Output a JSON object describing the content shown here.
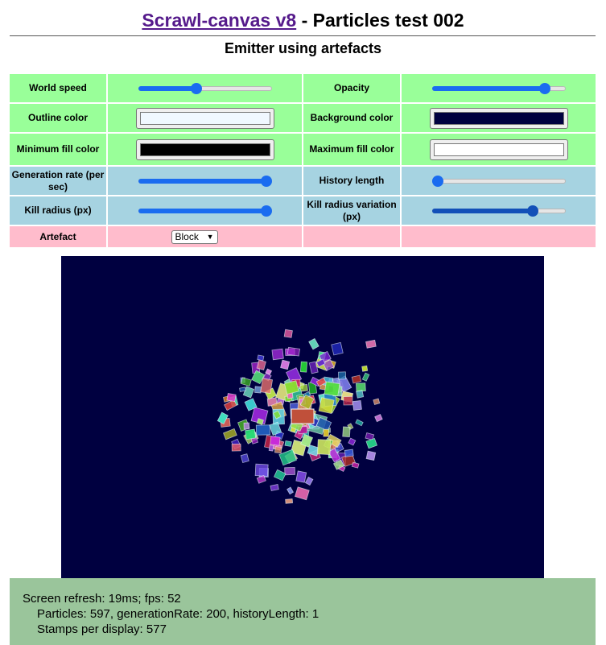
{
  "header": {
    "link_text": "Scrawl-canvas v8",
    "title_rest": " - Particles test 002",
    "subtitle": "Emitter using artefacts"
  },
  "controls": {
    "world_speed": {
      "label": "World speed",
      "value": 0.43
    },
    "opacity": {
      "label": "Opacity",
      "value": 0.88
    },
    "outline_color": {
      "label": "Outline color",
      "value": "#f0f8ff"
    },
    "background_color": {
      "label": "Background color",
      "value": "#000040"
    },
    "min_fill_color": {
      "label": "Minimum fill color",
      "value": "#000000"
    },
    "max_fill_color": {
      "label": "Maximum fill color",
      "value": "#ffffff"
    },
    "generation_rate": {
      "label": "Generation rate (per sec)",
      "value": 1.0
    },
    "history_length": {
      "label": "History length",
      "value": 0.0
    },
    "kill_radius": {
      "label": "Kill radius (px)",
      "value": 1.0
    },
    "kill_radius_variation": {
      "label": "Kill radius variation (px)",
      "value": 0.78
    },
    "artefact": {
      "label": "Artefact",
      "selected": "Block"
    }
  },
  "canvas": {
    "background": "#000040"
  },
  "stats": {
    "line1": "Screen refresh: 19ms; fps: 52",
    "line2": "Particles: 597, generationRate: 200, historyLength: 1",
    "line3": "Stamps per display: 577"
  }
}
